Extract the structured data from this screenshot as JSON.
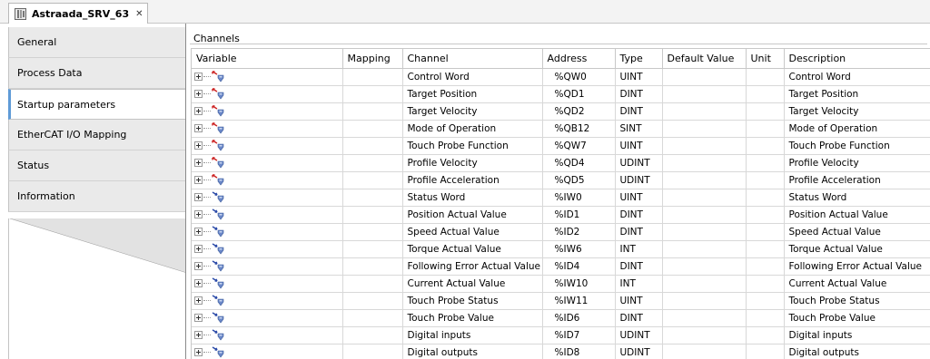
{
  "document": {
    "tab_title": "Astraada_SRV_63",
    "tab_icon": "device-icon",
    "close_glyph": "✕"
  },
  "sidebar": {
    "items": [
      {
        "label": "General",
        "selected": false
      },
      {
        "label": "Process Data",
        "selected": false
      },
      {
        "label": "Startup parameters",
        "selected": true
      },
      {
        "label": "EtherCAT I/O Mapping",
        "selected": false
      },
      {
        "label": "Status",
        "selected": false
      },
      {
        "label": "Information",
        "selected": false
      }
    ]
  },
  "channels": {
    "group_title": "Channels",
    "columns": [
      "Variable",
      "Mapping",
      "Channel",
      "Address",
      "Type",
      "Default Value",
      "Unit",
      "Description"
    ],
    "rows": [
      {
        "direction": "output",
        "variable": "",
        "mapping": "",
        "channel": "Control Word",
        "address": "%QW0",
        "type": "UINT",
        "default": "",
        "unit": "",
        "description": "Control Word"
      },
      {
        "direction": "output",
        "variable": "",
        "mapping": "",
        "channel": "Target Position",
        "address": "%QD1",
        "type": "DINT",
        "default": "",
        "unit": "",
        "description": "Target Position"
      },
      {
        "direction": "output",
        "variable": "",
        "mapping": "",
        "channel": "Target Velocity",
        "address": "%QD2",
        "type": "DINT",
        "default": "",
        "unit": "",
        "description": "Target Velocity"
      },
      {
        "direction": "output",
        "variable": "",
        "mapping": "",
        "channel": "Mode of Operation",
        "address": "%QB12",
        "type": "SINT",
        "default": "",
        "unit": "",
        "description": "Mode of Operation"
      },
      {
        "direction": "output",
        "variable": "",
        "mapping": "",
        "channel": "Touch Probe Function",
        "address": "%QW7",
        "type": "UINT",
        "default": "",
        "unit": "",
        "description": "Touch Probe Function"
      },
      {
        "direction": "output",
        "variable": "",
        "mapping": "",
        "channel": "Profile Velocity",
        "address": "%QD4",
        "type": "UDINT",
        "default": "",
        "unit": "",
        "description": "Profile Velocity"
      },
      {
        "direction": "output",
        "variable": "",
        "mapping": "",
        "channel": "Profile Acceleration",
        "address": "%QD5",
        "type": "UDINT",
        "default": "",
        "unit": "",
        "description": "Profile Acceleration"
      },
      {
        "direction": "input",
        "variable": "",
        "mapping": "",
        "channel": "Status Word",
        "address": "%IW0",
        "type": "UINT",
        "default": "",
        "unit": "",
        "description": "Status Word"
      },
      {
        "direction": "input",
        "variable": "",
        "mapping": "",
        "channel": "Position Actual Value",
        "address": "%ID1",
        "type": "DINT",
        "default": "",
        "unit": "",
        "description": "Position Actual Value"
      },
      {
        "direction": "input",
        "variable": "",
        "mapping": "",
        "channel": "Speed Actual Value",
        "address": "%ID2",
        "type": "DINT",
        "default": "",
        "unit": "",
        "description": "Speed Actual Value"
      },
      {
        "direction": "input",
        "variable": "",
        "mapping": "",
        "channel": "Torque Actual Value",
        "address": "%IW6",
        "type": "INT",
        "default": "",
        "unit": "",
        "description": "Torque Actual Value"
      },
      {
        "direction": "input",
        "variable": "",
        "mapping": "",
        "channel": "Following Error Actual Value",
        "address": "%ID4",
        "type": "DINT",
        "default": "",
        "unit": "",
        "description": "Following Error Actual Value"
      },
      {
        "direction": "input",
        "variable": "",
        "mapping": "",
        "channel": "Current Actual Value",
        "address": "%IW10",
        "type": "INT",
        "default": "",
        "unit": "",
        "description": "Current Actual Value"
      },
      {
        "direction": "input",
        "variable": "",
        "mapping": "",
        "channel": "Touch Probe Status",
        "address": "%IW11",
        "type": "UINT",
        "default": "",
        "unit": "",
        "description": "Touch Probe Status"
      },
      {
        "direction": "input",
        "variable": "",
        "mapping": "",
        "channel": "Touch Probe Value",
        "address": "%ID6",
        "type": "DINT",
        "default": "",
        "unit": "",
        "description": "Touch Probe Value"
      },
      {
        "direction": "input",
        "variable": "",
        "mapping": "",
        "channel": "Digital inputs",
        "address": "%ID7",
        "type": "UDINT",
        "default": "",
        "unit": "",
        "description": "Digital inputs"
      },
      {
        "direction": "input",
        "variable": "",
        "mapping": "",
        "channel": "Digital outputs",
        "address": "%ID8",
        "type": "UDINT",
        "default": "",
        "unit": "",
        "description": "Digital outputs"
      }
    ]
  },
  "colors": {
    "selected_tab_accent": "#5f9bd7",
    "output_arrow": "#cc2222",
    "input_arrow": "#2b4aa8",
    "io_icon": "#6a87c8"
  }
}
